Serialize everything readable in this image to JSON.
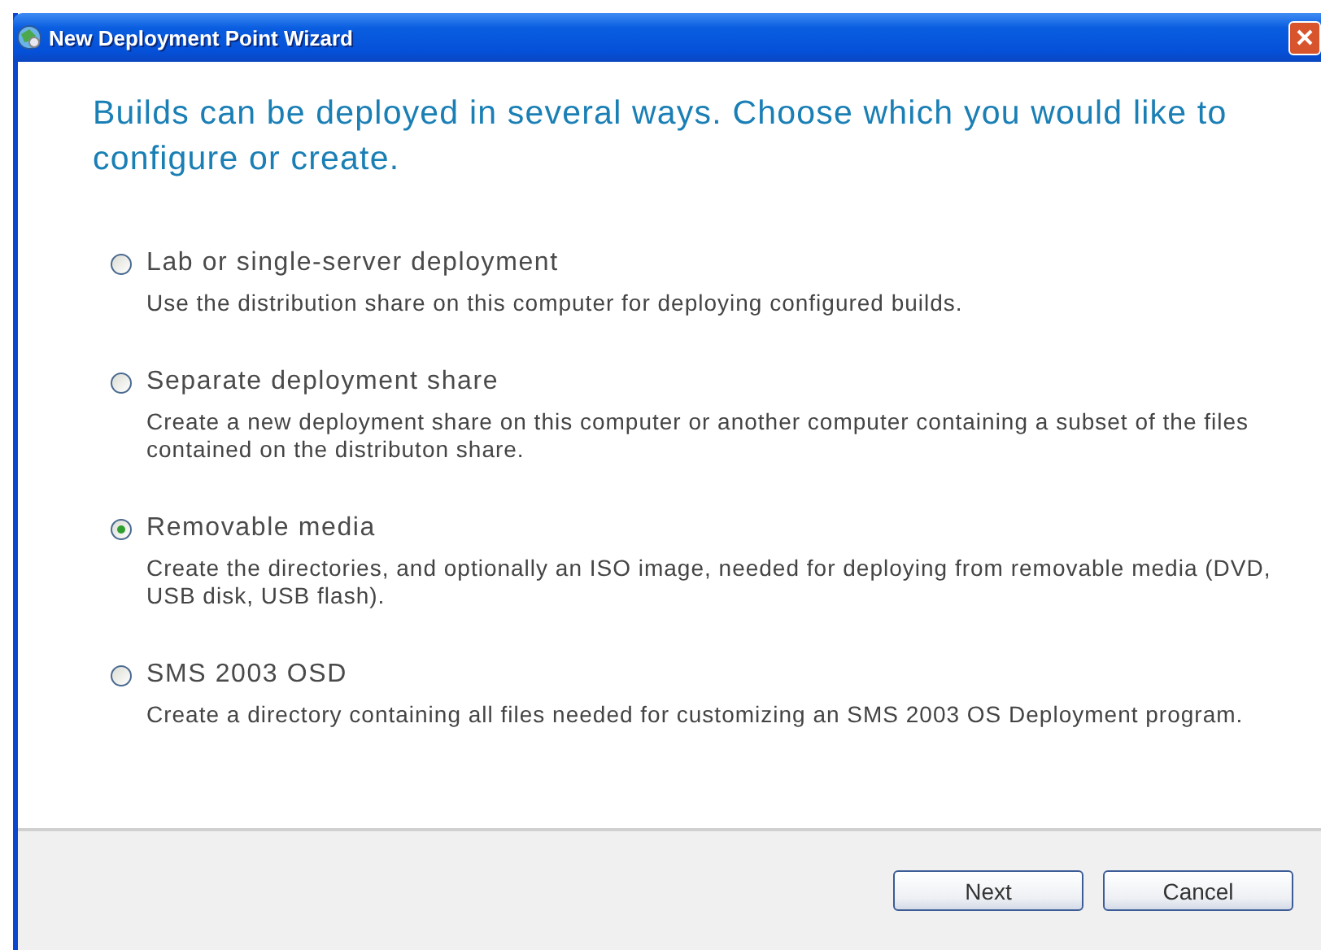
{
  "window": {
    "title": "New Deployment Point Wizard"
  },
  "heading": "Builds can be deployed in several ways. Choose which you would like to configure or create.",
  "options": [
    {
      "label": "Lab or single-server deployment",
      "description": "Use the distribution share on this computer for deploying configured builds.",
      "selected": false
    },
    {
      "label": "Separate deployment share",
      "description": "Create a new deployment share on this computer or another computer containing a subset of the files contained on the distributon share.",
      "selected": false
    },
    {
      "label": "Removable media",
      "description": "Create the directories, and optionally an ISO image, needed for deploying from removable media (DVD, USB disk, USB flash).",
      "selected": true
    },
    {
      "label": "SMS 2003 OSD",
      "description": "Create a directory containing all files needed for customizing an SMS 2003 OS Deployment program.",
      "selected": false
    }
  ],
  "buttons": [
    "Next",
    "Cancel"
  ]
}
